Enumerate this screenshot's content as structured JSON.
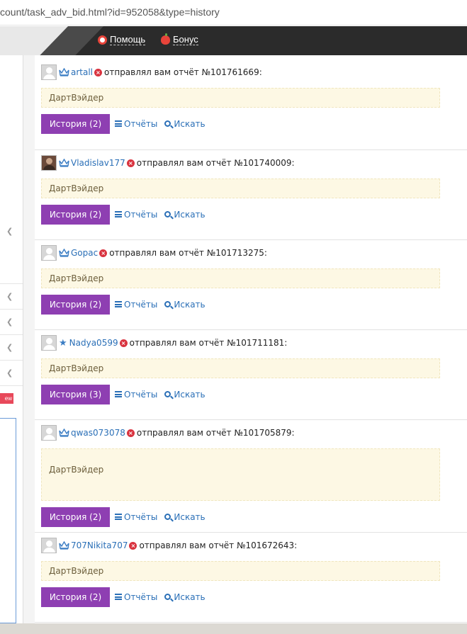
{
  "browser": {
    "url": "count/task_adv_bid.html?id=952058&type=history"
  },
  "topbar": {
    "help_label": "Помощь",
    "bonus_label": "Бонус",
    "help_icon": "lifebuoy-icon",
    "bonus_icon": "apple-icon"
  },
  "sidebar": {
    "badge": "ew"
  },
  "reports": [
    {
      "user": "artall",
      "rank_icon": "crown-icon",
      "text": "отправлял вам отчёт №101761669:",
      "note": "ДартВэйдер",
      "history_label": "История (2)",
      "reports_label": "Отчёты",
      "search_label": "Искать"
    },
    {
      "user": "Vladislav177",
      "rank_icon": "crown-icon",
      "text": "отправлял вам отчёт №101740009:",
      "note": "ДартВэйдер",
      "history_label": "История (2)",
      "reports_label": "Отчёты",
      "search_label": "Искать"
    },
    {
      "user": "Gopac",
      "rank_icon": "crown-icon",
      "text": "отправлял вам отчёт №101713275:",
      "note": "ДартВэйдер",
      "history_label": "История (2)",
      "reports_label": "Отчёты",
      "search_label": "Искать"
    },
    {
      "user": "Nadya0599",
      "rank_icon": "star-icon",
      "text": "отправлял вам отчёт №101711181:",
      "note": "ДартВэйдер",
      "history_label": "История (3)",
      "reports_label": "Отчёты",
      "search_label": "Искать"
    },
    {
      "user": "qwas073078",
      "rank_icon": "crown-icon",
      "text": "отправлял вам отчёт №101705879:",
      "note": "ДартВэйдер",
      "history_label": "История (2)",
      "reports_label": "Отчёты",
      "search_label": "Искать"
    },
    {
      "user": "707Nikita707",
      "rank_icon": "crown-icon",
      "text": "отправлял вам отчёт №101672643:",
      "note": "ДартВэйдер",
      "history_label": "История (2)",
      "reports_label": "Отчёты",
      "search_label": "Искать"
    }
  ],
  "colors": {
    "accent_purple": "#8e3fb2",
    "link_blue": "#2a6fb7",
    "note_bg": "#fdf8e4",
    "header_dark": "#2b2b2b"
  }
}
